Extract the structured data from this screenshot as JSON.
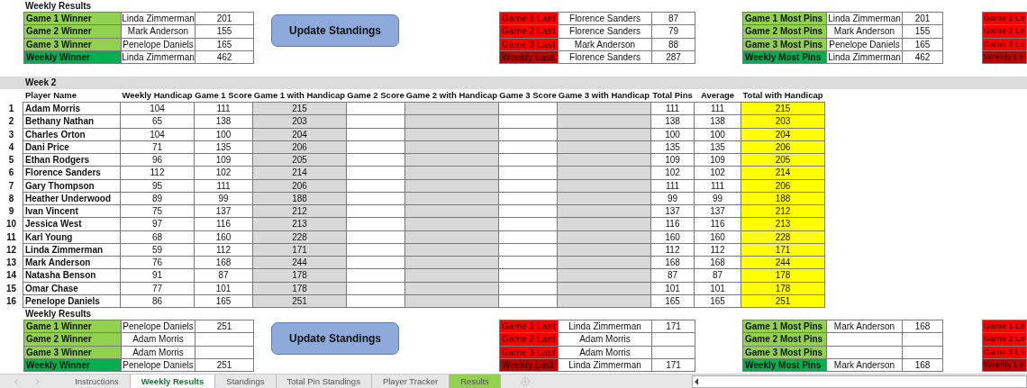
{
  "weekly_results_top": {
    "title": "Weekly Results",
    "winners": [
      {
        "kind": "game",
        "label": "Game 1 Winner",
        "name": "Linda Zimmerman",
        "score": "201"
      },
      {
        "kind": "game",
        "label": "Game 2 Winner",
        "name": "Mark Anderson",
        "score": "155"
      },
      {
        "kind": "game",
        "label": "Game 3 Winner",
        "name": "Penelope Daniels",
        "score": "165"
      },
      {
        "kind": "weekly",
        "label": "Weekly Winner",
        "name": "Linda Zimmerman",
        "score": "462"
      }
    ],
    "button": "Update Standings",
    "lasts": [
      {
        "kind": "game",
        "label": "Game 1 Last",
        "name": "Florence Sanders",
        "score": "87"
      },
      {
        "kind": "game",
        "label": "Game 2 Last",
        "name": "Florence Sanders",
        "score": "79"
      },
      {
        "kind": "game",
        "label": "Game 3 Last",
        "name": "Mark Anderson",
        "score": "88"
      },
      {
        "kind": "weekly",
        "label": "Weekly Last",
        "name": "Florence Sanders",
        "score": "287"
      }
    ],
    "most_pins": [
      {
        "kind": "game",
        "label": "Game 1 Most Pins",
        "name": "Linda Zimmerman",
        "score": "201"
      },
      {
        "kind": "game",
        "label": "Game 2 Most Pins",
        "name": "Mark Anderson",
        "score": "155"
      },
      {
        "kind": "game",
        "label": "Game 3 Most Pins",
        "name": "Penelope Daniels",
        "score": "165"
      },
      {
        "kind": "weekly",
        "label": "Weekly Most Pins",
        "name": "Linda Zimmerman",
        "score": "462"
      }
    ],
    "leaders": [
      {
        "kind": "game",
        "label": "Game 1 Le"
      },
      {
        "kind": "game",
        "label": "Game 2 Le"
      },
      {
        "kind": "game",
        "label": "Game 3 Le"
      },
      {
        "kind": "weekly",
        "label": "Weekly Le"
      }
    ]
  },
  "week": {
    "title": "Week 2",
    "columns": [
      "Player Name",
      "Weekly Handicap",
      "Game 1 Score",
      "Game 1 with Handicap",
      "Game 2 Score",
      "Game 2 with Handicap",
      "Game 3 Score",
      "Game 3 with Handicap",
      "Total Pins",
      "Average",
      "Total with Handicap"
    ],
    "rows": [
      {
        "number": "1",
        "player": "Adam Morris",
        "weekly_handicap": "104",
        "game_1_score": "111",
        "game_1_with_handicap": "215",
        "total_pins": "111",
        "average": "111",
        "total_with_handicap": "215"
      },
      {
        "number": "2",
        "player": "Bethany Nathan",
        "weekly_handicap": "65",
        "game_1_score": "138",
        "game_1_with_handicap": "203",
        "total_pins": "138",
        "average": "138",
        "total_with_handicap": "203"
      },
      {
        "number": "3",
        "player": "Charles Orton",
        "weekly_handicap": "104",
        "game_1_score": "100",
        "game_1_with_handicap": "204",
        "total_pins": "100",
        "average": "100",
        "total_with_handicap": "204"
      },
      {
        "number": "4",
        "player": "Dani Price",
        "weekly_handicap": "71",
        "game_1_score": "135",
        "game_1_with_handicap": "206",
        "total_pins": "135",
        "average": "135",
        "total_with_handicap": "206"
      },
      {
        "number": "5",
        "player": "Ethan Rodgers",
        "weekly_handicap": "96",
        "game_1_score": "109",
        "game_1_with_handicap": "205",
        "total_pins": "109",
        "average": "109",
        "total_with_handicap": "205"
      },
      {
        "number": "6",
        "player": "Florence Sanders",
        "weekly_handicap": "112",
        "game_1_score": "102",
        "game_1_with_handicap": "214",
        "total_pins": "102",
        "average": "102",
        "total_with_handicap": "214"
      },
      {
        "number": "7",
        "player": "Gary Thompson",
        "weekly_handicap": "95",
        "game_1_score": "111",
        "game_1_with_handicap": "206",
        "total_pins": "111",
        "average": "111",
        "total_with_handicap": "206"
      },
      {
        "number": "8",
        "player": "Heather Underwood",
        "weekly_handicap": "89",
        "game_1_score": "99",
        "game_1_with_handicap": "188",
        "total_pins": "99",
        "average": "99",
        "total_with_handicap": "188"
      },
      {
        "number": "9",
        "player": "Ivan Vincent",
        "weekly_handicap": "75",
        "game_1_score": "137",
        "game_1_with_handicap": "212",
        "total_pins": "137",
        "average": "137",
        "total_with_handicap": "212"
      },
      {
        "number": "10",
        "player": "Jessica West",
        "weekly_handicap": "97",
        "game_1_score": "116",
        "game_1_with_handicap": "213",
        "total_pins": "116",
        "average": "116",
        "total_with_handicap": "213"
      },
      {
        "number": "11",
        "player": "Karl Young",
        "weekly_handicap": "68",
        "game_1_score": "160",
        "game_1_with_handicap": "228",
        "total_pins": "160",
        "average": "160",
        "total_with_handicap": "228"
      },
      {
        "number": "12",
        "player": "Linda Zimmerman",
        "weekly_handicap": "59",
        "game_1_score": "112",
        "game_1_with_handicap": "171",
        "total_pins": "112",
        "average": "112",
        "total_with_handicap": "171"
      },
      {
        "number": "13",
        "player": "Mark Anderson",
        "weekly_handicap": "76",
        "game_1_score": "168",
        "game_1_with_handicap": "244",
        "total_pins": "168",
        "average": "168",
        "total_with_handicap": "244"
      },
      {
        "number": "14",
        "player": "Natasha Benson",
        "weekly_handicap": "91",
        "game_1_score": "87",
        "game_1_with_handicap": "178",
        "total_pins": "87",
        "average": "87",
        "total_with_handicap": "178"
      },
      {
        "number": "15",
        "player": "Omar Chase",
        "weekly_handicap": "77",
        "game_1_score": "101",
        "game_1_with_handicap": "178",
        "total_pins": "101",
        "average": "101",
        "total_with_handicap": "178"
      },
      {
        "number": "16",
        "player": "Penelope Daniels",
        "weekly_handicap": "86",
        "game_1_score": "165",
        "game_1_with_handicap": "251",
        "total_pins": "165",
        "average": "165",
        "total_with_handicap": "251"
      }
    ]
  },
  "weekly_results_bottom": {
    "title": "Weekly Results",
    "winners": [
      {
        "kind": "game",
        "label": "Game 1 Winner",
        "name": "Penelope Daniels",
        "score": "251"
      },
      {
        "kind": "game",
        "label": "Game 2 Winner",
        "name": "Adam Morris"
      },
      {
        "kind": "game",
        "label": "Game 3 Winner",
        "name": "Adam Morris"
      },
      {
        "kind": "weekly",
        "label": "Weekly Winner",
        "name": "Penelope Daniels",
        "score": "251"
      }
    ],
    "button": "Update Standings",
    "lasts": [
      {
        "kind": "game",
        "label": "Game 1 Last",
        "name": "Linda Zimmerman",
        "score": "171"
      },
      {
        "kind": "game",
        "label": "Game 2 Last",
        "name": "Adam Morris"
      },
      {
        "kind": "game",
        "label": "Game 3 Last",
        "name": "Adam Morris"
      },
      {
        "kind": "weekly",
        "label": "Weekly Last",
        "name": "Linda Zimmerman",
        "score": "171"
      }
    ],
    "most_pins": [
      {
        "kind": "game",
        "label": "Game 1 Most Pins",
        "name": "Mark Anderson",
        "score": "168"
      },
      {
        "kind": "game",
        "label": "Game 2 Most Pins"
      },
      {
        "kind": "game",
        "label": "Game 3 Most Pins"
      },
      {
        "kind": "weekly",
        "label": "Weekly Most Pins",
        "name": "Mark Anderson",
        "score": "168"
      }
    ],
    "leaders": [
      {
        "kind": "game",
        "label": "Game 1 Le"
      },
      {
        "kind": "game",
        "label": "Game 2 Le"
      },
      {
        "kind": "game",
        "label": "Game 3 Le"
      },
      {
        "kind": "weekly",
        "label": "Weekly Le"
      }
    ]
  },
  "sheet_tabs": [
    {
      "label": "Instructions",
      "selected": false
    },
    {
      "label": "Weekly Results",
      "selected": true
    },
    {
      "label": "Standings",
      "selected": false
    },
    {
      "label": "Total Pin Standings",
      "selected": false
    },
    {
      "label": "Player Tracker",
      "selected": false
    },
    {
      "label": "Results",
      "selected": false,
      "color": "#92d050"
    }
  ]
}
